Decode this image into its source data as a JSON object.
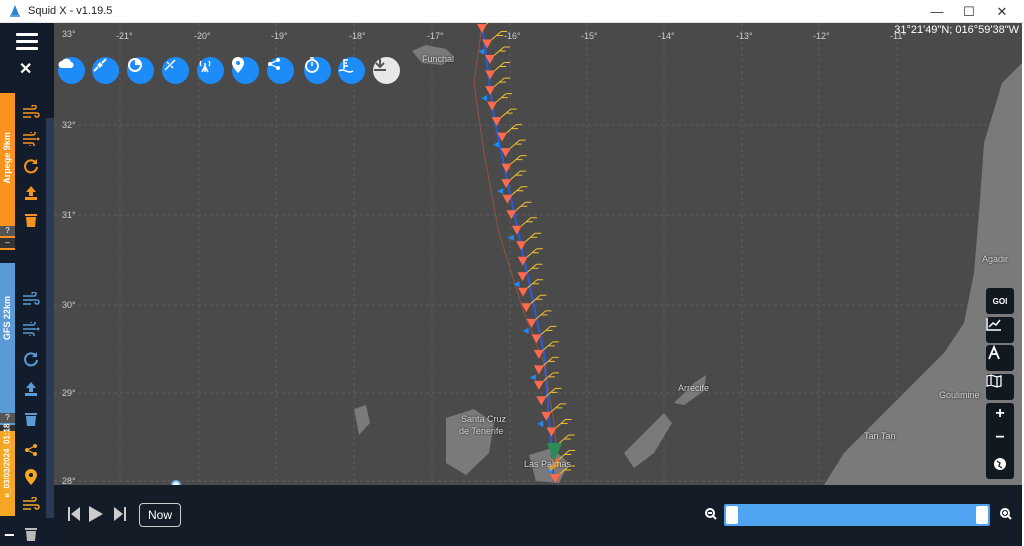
{
  "window": {
    "title": "Squid X - v1.19.5",
    "minimize": "—",
    "maximize": "☐",
    "close": "✕"
  },
  "coordinates": "31°21'49\"N; 016°59'38\"W",
  "longitude_labels": [
    "-21°",
    "-20°",
    "-19°",
    "-18°",
    "-17°",
    "-16°",
    "-15°",
    "-14°",
    "-13°",
    "-12°",
    "-11°"
  ],
  "longitude_left": "33°",
  "latitude_labels": [
    "32°",
    "31°",
    "30°",
    "29°",
    "28°"
  ],
  "places": [
    "Funchal",
    "Santa Cruz",
    "de Tenerife",
    "Las Palmas",
    "Arrecife",
    "Agadir",
    "Tan Tan",
    "Goulimine"
  ],
  "panels": [
    {
      "label": "Arpege 9km",
      "color": "#f7931e"
    },
    {
      "label": "GFS 22km",
      "color": "#5b9bd5"
    },
    {
      "label": "e_03/03/2024_01:18",
      "color": "#f5a623"
    }
  ],
  "panel_help": "?",
  "panel_collapse": "–",
  "toolbar_icons": [
    "cloud-icon",
    "satellite-icon",
    "weather-icon",
    "sail-icon",
    "antenna-icon",
    "location-icon",
    "share-icon",
    "timer-icon",
    "tide-icon",
    "download-icon"
  ],
  "right_buttons": {
    "goi": "GOI",
    "zoom_in": "+",
    "zoom_out": "−"
  },
  "bottom": {
    "now_label": "Now",
    "zoom_out_icon": "🔍",
    "zoom_in_icon": "🔍"
  },
  "colors": {
    "accent": "#1d8cf8",
    "route": "#2a5bd7",
    "wind": "#ff6a4d",
    "barb": "#f2c12e"
  }
}
